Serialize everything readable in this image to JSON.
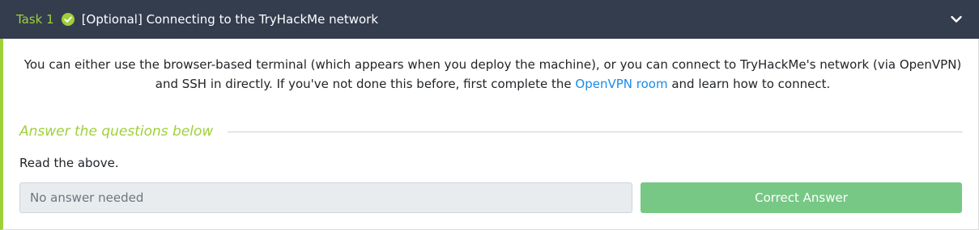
{
  "task": {
    "number_label": "Task 1",
    "status_icon": "check-circle-icon",
    "title": "[Optional] Connecting to the TryHackMe network",
    "expand_icon": "chevron-down-icon"
  },
  "body": {
    "description_before_link": "You can either use the browser-based terminal (which appears when you deploy the machine), or you can connect to TryHackMe's network (via OpenVPN) and SSH in directly. If you've not done this before, first complete the ",
    "link_text": "OpenVPN room",
    "description_after_link": " and learn how to connect.",
    "questions_heading": "Answer the questions below",
    "question": "Read the above.",
    "answer_placeholder": "No answer needed",
    "answer_button": "Correct Answer"
  },
  "colors": {
    "header_bg": "#343d4e",
    "accent_green": "#9fd038",
    "button_green": "#77c885",
    "link_blue": "#1a8be6"
  }
}
